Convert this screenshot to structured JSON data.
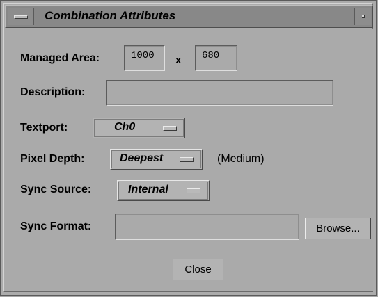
{
  "window": {
    "title": "Combination Attributes"
  },
  "form": {
    "managed_area_label": "Managed Area:",
    "managed_area_width": "1000",
    "managed_area_x": "x",
    "managed_area_height": "680",
    "description_label": "Description:",
    "description_value": "",
    "textport_label": "Textport:",
    "textport_value": "Ch0",
    "pixel_depth_label": "Pixel Depth:",
    "pixel_depth_value": "Deepest",
    "pixel_depth_note": "(Medium)",
    "sync_source_label": "Sync Source:",
    "sync_source_value": "Internal",
    "sync_format_label": "Sync Format:",
    "sync_format_value": "",
    "browse_label": "Browse...",
    "close_label": "Close"
  }
}
